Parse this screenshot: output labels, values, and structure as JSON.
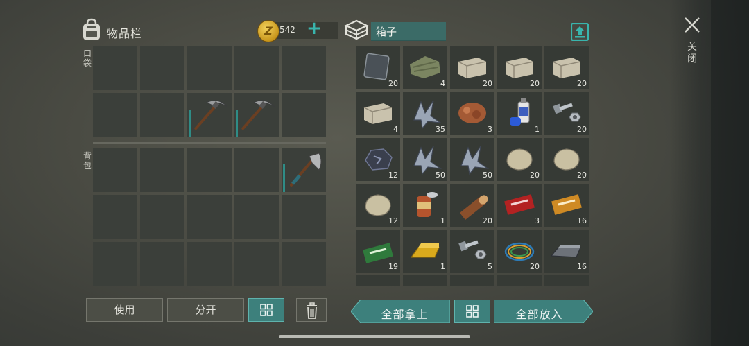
{
  "inventory": {
    "title": "物品栏",
    "coin_symbol": "Z",
    "coins": "542",
    "add_label": "+",
    "pocket_label": "口袋",
    "backpack_label": "背包",
    "pocket_slots": [
      "",
      "",
      "",
      "",
      "",
      "",
      "",
      "pickaxe",
      "pickaxe",
      ""
    ],
    "backpack_slots": [
      "",
      "",
      "",
      "",
      "hatchet",
      "",
      "",
      "",
      "",
      "",
      "",
      "",
      "",
      "",
      ""
    ]
  },
  "box": {
    "title": "箱子",
    "items": [
      {
        "icon": "metal-plate-icon",
        "qty": "20"
      },
      {
        "icon": "cloth-icon",
        "qty": "4"
      },
      {
        "icon": "stone-brick-icon",
        "qty": "20"
      },
      {
        "icon": "stone-brick-icon",
        "qty": "20"
      },
      {
        "icon": "stone-brick-icon",
        "qty": "20"
      },
      {
        "icon": "stone-brick-icon",
        "qty": "4"
      },
      {
        "icon": "iron-ore-shard-icon",
        "qty": "35"
      },
      {
        "icon": "copper-ore-icon",
        "qty": "3"
      },
      {
        "icon": "spray-can-icon",
        "qty": "1"
      },
      {
        "icon": "bolt-nut-icon",
        "qty": "20"
      },
      {
        "icon": "coal-icon",
        "qty": "12"
      },
      {
        "icon": "iron-ore-shard-icon",
        "qty": "50"
      },
      {
        "icon": "iron-ore-shard-icon",
        "qty": "50"
      },
      {
        "icon": "rock-icon",
        "qty": "20"
      },
      {
        "icon": "rock-icon",
        "qty": "20"
      },
      {
        "icon": "rock-icon",
        "qty": "12"
      },
      {
        "icon": "tin-can-icon",
        "qty": "1"
      },
      {
        "icon": "log-icon",
        "qty": "20"
      },
      {
        "icon": "red-coupon-icon",
        "qty": "3"
      },
      {
        "icon": "orange-coupon-icon",
        "qty": "16"
      },
      {
        "icon": "green-coupon-icon",
        "qty": "19"
      },
      {
        "icon": "gold-bar-icon",
        "qty": "1"
      },
      {
        "icon": "bolt-nut-icon",
        "qty": "5"
      },
      {
        "icon": "wire-icon",
        "qty": "20"
      },
      {
        "icon": "steel-ingot-icon",
        "qty": "16"
      },
      {
        "icon": "",
        "qty": ""
      },
      {
        "icon": "",
        "qty": ""
      },
      {
        "icon": "",
        "qty": ""
      },
      {
        "icon": "",
        "qty": ""
      },
      {
        "icon": "",
        "qty": ""
      }
    ]
  },
  "buttons": {
    "use": "使用",
    "split": "分开",
    "take_all": "全部拿上",
    "put_all": "全部放入",
    "close": "关闭"
  },
  "colors": {
    "accent_teal": "#3d807c",
    "coin_gold": "#e0b23a"
  }
}
